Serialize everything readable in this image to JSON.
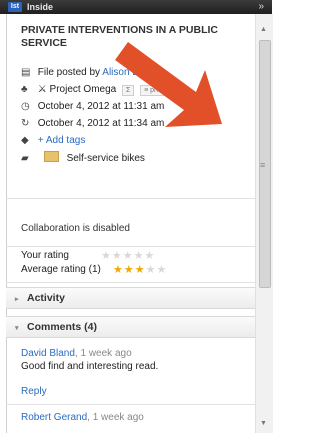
{
  "app": {
    "logo_text": "Ist",
    "title": "Inside",
    "collapse_glyph": "»"
  },
  "document": {
    "title": "PRIVATE INTERVENTIONS IN A PUBLIC SERVICE",
    "posted_prefix": "File posted by",
    "author": "Alison Dupont",
    "project": "Project Omega",
    "project_badge_a": "Σ",
    "project_badge_b": "≡ private",
    "created": "October 4, 2012 at 11:31 am",
    "modified": "October 4, 2012 at 11:34 am",
    "add_tags": "+ Add tags",
    "folder": "Self-service bikes"
  },
  "collaboration_status": "Collaboration is disabled",
  "ratings": {
    "your_label": "Your rating",
    "your_value": 0,
    "average_label": "Average rating (1)",
    "average_value": 3,
    "max": 5
  },
  "sections": {
    "activity": {
      "label": "Activity",
      "glyph": "▸"
    },
    "comments": {
      "label": "Comments (4)",
      "glyph": "▾"
    }
  },
  "comments": [
    {
      "author": "David Bland",
      "time": ", 1 week ago",
      "text": "Good find and interesting read.",
      "reply": "Reply"
    },
    {
      "author": "Robert Gerand",
      "time": ", 1 week ago"
    }
  ],
  "icons": [
    "file-icon",
    "project-icon",
    "clock-icon",
    "refresh-icon",
    "tag-icon",
    "folder-icon"
  ],
  "colors": {
    "link": "#2c6bbf",
    "star_on": "#f0a800",
    "arrow": "#e2502a"
  }
}
